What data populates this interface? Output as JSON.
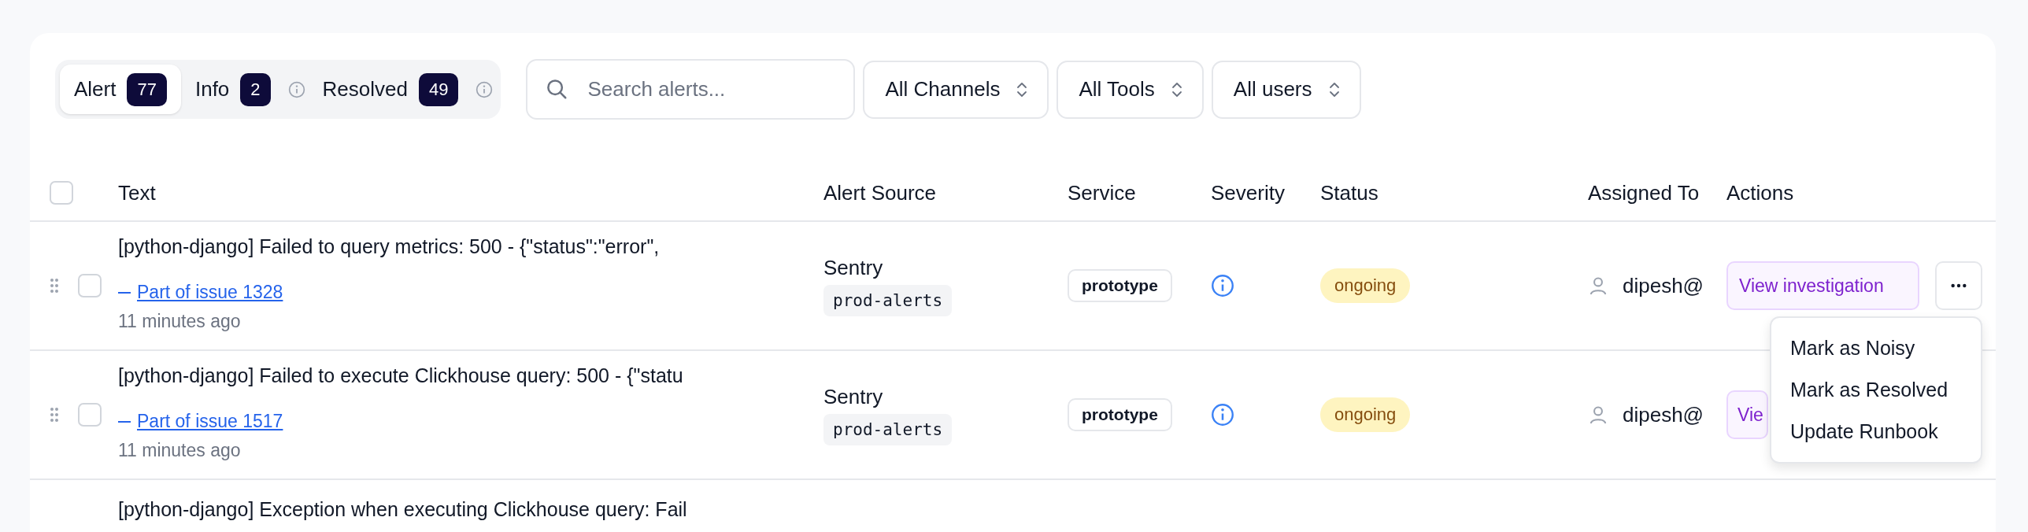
{
  "tabs": [
    {
      "label": "Alert",
      "count": "77",
      "selected": true,
      "info_icon": false
    },
    {
      "label": "Info",
      "count": "2",
      "selected": false,
      "info_icon": true
    },
    {
      "label": "Resolved",
      "count": "49",
      "selected": false,
      "info_icon": true
    }
  ],
  "search": {
    "placeholder": "Search alerts..."
  },
  "filters": [
    {
      "label": "All Channels"
    },
    {
      "label": "All Tools"
    },
    {
      "label": "All users"
    }
  ],
  "table": {
    "select_all": {
      "checked": false
    },
    "columns": [
      "Text",
      "Alert Source",
      "Service",
      "Severity",
      "Status",
      "Assigned To",
      "Actions"
    ],
    "rows": [
      {
        "checked": false,
        "text": "[python-django] Failed to query metrics: 500 - {\"status\":\"error\",",
        "issue_link": "Part of issue 1328",
        "time": "11 minutes ago",
        "source": "Sentry",
        "channel": "prod-alerts",
        "service": "prototype",
        "status": "ongoing",
        "assignee": "dipesh@",
        "action": "View investigation",
        "more_button": true,
        "menu_open": true
      },
      {
        "checked": false,
        "text": "[python-django] Failed to execute Clickhouse query: 500 - {\"statu",
        "issue_link": "Part of issue 1517",
        "time": "11 minutes ago",
        "source": "Sentry",
        "channel": "prod-alerts",
        "service": "prototype",
        "status": "ongoing",
        "assignee": "dipesh@",
        "action": "Vie",
        "more_button": false,
        "menu_open": false
      },
      {
        "text": "[python-django] Exception when executing Clickhouse query: Fail"
      }
    ]
  },
  "menu": {
    "items": [
      "Mark as Noisy",
      "Mark as Resolved",
      "Update Runbook"
    ]
  }
}
